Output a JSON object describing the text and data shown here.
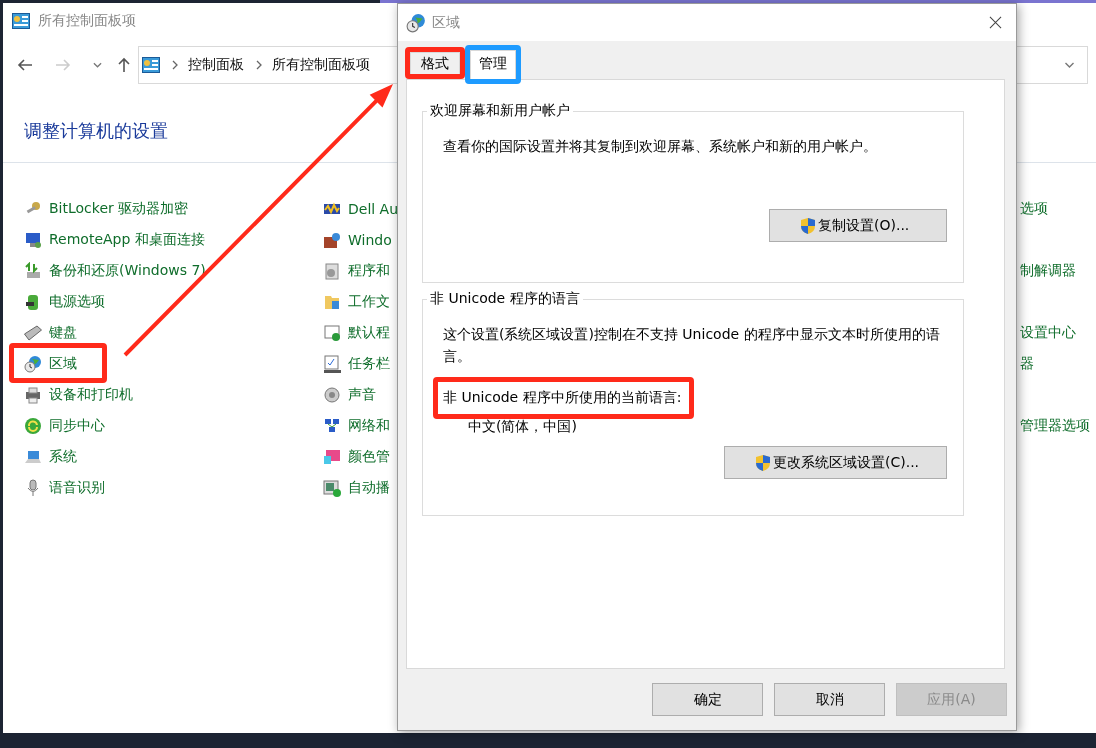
{
  "background_window": {
    "title": "所有控制面板项",
    "breadcrumb": [
      "控制面板",
      "所有控制面板项"
    ],
    "heading": "调整计算机的设置",
    "columns": [
      [
        {
          "label": "BitLocker 驱动器加密"
        },
        {
          "label": "RemoteApp 和桌面连接"
        },
        {
          "label": "备份和还原(Windows 7)"
        },
        {
          "label": "电源选项"
        },
        {
          "label": "键盘"
        },
        {
          "label": "区域",
          "highlight": {
            "color": "#ff2a1a"
          }
        },
        {
          "label": "设备和打印机"
        },
        {
          "label": "同步中心"
        },
        {
          "label": "系统"
        },
        {
          "label": "语音识别"
        }
      ],
      [
        {
          "label": "Dell Au"
        },
        {
          "label": "Windo"
        },
        {
          "label": "程序和"
        },
        {
          "label": "工作文"
        },
        {
          "label": "默认程"
        },
        {
          "label": "任务栏"
        },
        {
          "label": "声音"
        },
        {
          "label": "网络和"
        },
        {
          "label": "颜色管"
        },
        {
          "label": "自动播"
        }
      ],
      [
        {
          "label": "选项"
        },
        null,
        {
          "label": "制解调器"
        },
        null,
        {
          "label": "设置中心"
        },
        {
          "label": "器"
        },
        null,
        {
          "label": "管理器选项"
        }
      ]
    ]
  },
  "dialog": {
    "title": "区域",
    "tabs": [
      {
        "label": "格式",
        "selected": false,
        "highlight": {
          "color": "#ff2a1a"
        }
      },
      {
        "label": "管理",
        "selected": true,
        "highlight": {
          "color": "#1e9bff"
        }
      }
    ],
    "groups": [
      {
        "legend": "欢迎屏幕和新用户帐户",
        "text": "查看你的国际设置并将其复制到欢迎屏幕、系统帐户和新的用户帐户。",
        "button": "复制设置(O)..."
      },
      {
        "legend": "非 Unicode 程序的语言",
        "text": "这个设置(系统区域设置)控制在不支持 Unicode 的程序中显示文本时所使用的语言。",
        "current_label": "非 Unicode 程序中所使用的当前语言:",
        "current_label_highlight": {
          "color": "#ff2a1a"
        },
        "current_value": "中文(简体，中国)",
        "button": "更改系统区域设置(C)..."
      }
    ],
    "buttons": [
      {
        "label": "确定",
        "disabled": false
      },
      {
        "label": "取消",
        "disabled": false
      },
      {
        "label": "应用(A)",
        "disabled": true
      }
    ]
  }
}
